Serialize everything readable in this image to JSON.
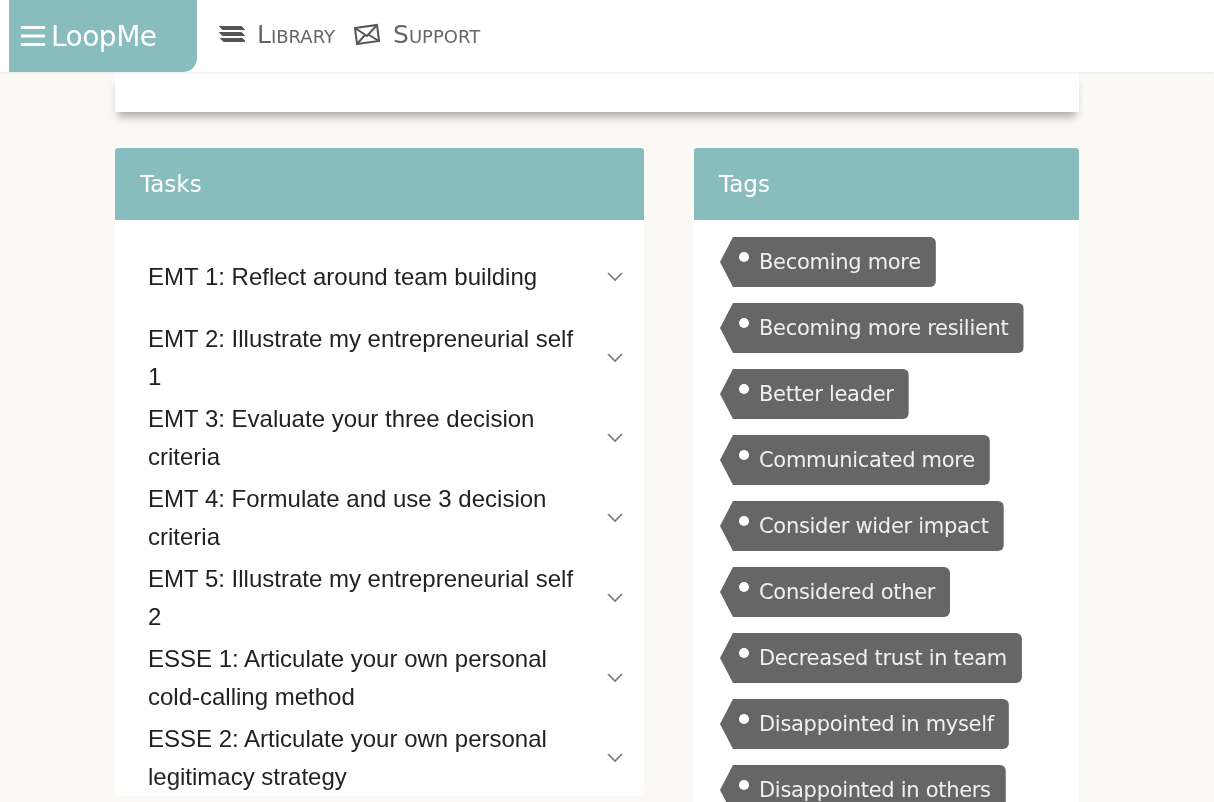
{
  "header": {
    "logo": "LoopMe",
    "nav": [
      {
        "label": "Library",
        "kind": "books"
      },
      {
        "label": "Support",
        "kind": "mail"
      }
    ]
  },
  "tasks": {
    "title": "Tasks",
    "items": [
      {
        "label": "EMT 1: Reflect around team building",
        "expanded": false
      },
      {
        "label": "EMT 2: Illustrate my entrepreneurial self 1",
        "expanded": false
      },
      {
        "label": "EMT 3: Evaluate your three decision criteria",
        "expanded": false
      },
      {
        "label": "EMT 4: Formulate and use 3 decision criteria",
        "expanded": false
      },
      {
        "label": "EMT 5: Illustrate my entrepreneurial self 2",
        "expanded": false
      },
      {
        "label": "ESSE 1: Articulate your own personal cold-calling method",
        "expanded": false
      },
      {
        "label": "ESSE 2: Articulate your own personal legitimacy strategy",
        "expanded": false
      }
    ]
  },
  "tags": {
    "title": "Tags",
    "items": [
      "Becoming more",
      "Becoming more resilient",
      "Better leader",
      "Communicated more",
      "Consider wider impact",
      "Considered other",
      "Decreased trust in team",
      "Disappointed in myself",
      "Disappointed in others"
    ]
  }
}
